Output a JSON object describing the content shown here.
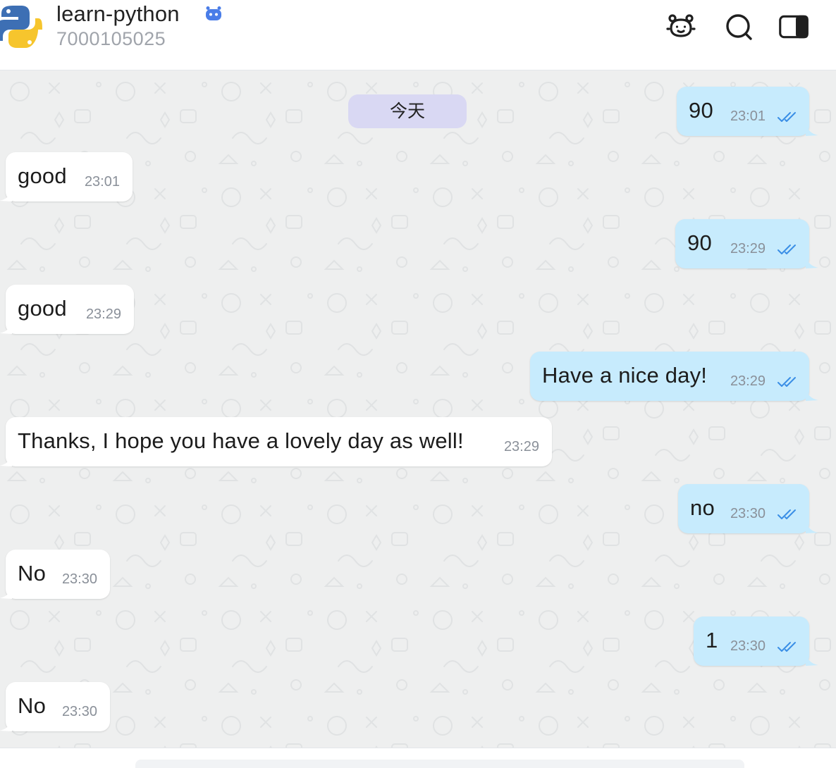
{
  "header": {
    "title": "learn-python",
    "subtitle": "7000105025",
    "avatar_icon": "python-logo-icon",
    "badge_icon": "bot-badge-icon",
    "actions": [
      {
        "name": "bot-icon"
      },
      {
        "name": "search-icon"
      },
      {
        "name": "sidebar-toggle-icon"
      }
    ]
  },
  "chat": {
    "date_label": "今天",
    "colors": {
      "background": "#eeefef",
      "incoming_bubble": "#ffffff",
      "outgoing_bubble": "#c7ebfd",
      "check": "#3a8ee6",
      "date_pill": "#d9d8f3"
    },
    "messages": [
      {
        "direction": "out",
        "text": "90",
        "time": "23:01",
        "status": "read"
      },
      {
        "direction": "in",
        "text": "good",
        "time": "23:01"
      },
      {
        "direction": "out",
        "text": "90",
        "time": "23:29",
        "status": "read"
      },
      {
        "direction": "in",
        "text": "good",
        "time": "23:29"
      },
      {
        "direction": "out",
        "text": "Have a nice day!",
        "time": "23:29",
        "status": "read"
      },
      {
        "direction": "in",
        "text": "Thanks, I hope you have a lovely day as well!",
        "time": "23:29"
      },
      {
        "direction": "out",
        "text": "no",
        "time": "23:30",
        "status": "read"
      },
      {
        "direction": "in",
        "text": "No",
        "time": "23:30"
      },
      {
        "direction": "out",
        "text": "1",
        "time": "23:30",
        "status": "read"
      },
      {
        "direction": "in",
        "text": "No",
        "time": "23:30"
      }
    ]
  },
  "composer": {
    "placeholder": ""
  }
}
